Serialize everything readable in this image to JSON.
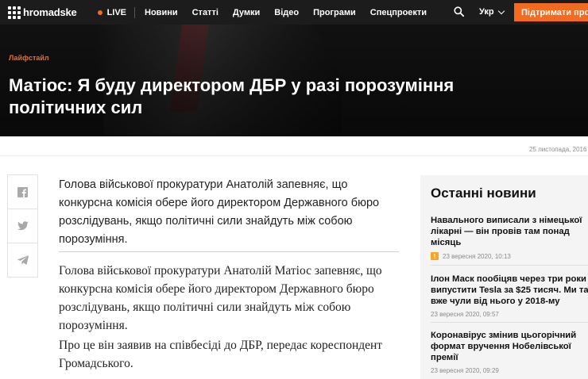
{
  "header": {
    "logo_text": "hromadske",
    "live_label": "LIVE",
    "nav": [
      "Новини",
      "Статті",
      "Думки",
      "Відео",
      "Програми",
      "Спецпроекти"
    ],
    "language": "Укр",
    "support_label": "Підтримати проект"
  },
  "hero": {
    "category": "Лайфстайл",
    "title": "Матіос: Я буду директором ДБР у разі порозуміння політичних сил"
  },
  "article": {
    "date": "25 листопада, 2016",
    "lead": "Голова військової прокуратури Анатолій запевняє, що конкурсна комісія обере його директором Державного бюро розслідувань, якщо політичні сили знайдуть між собою порозуміння.",
    "paragraphs": [
      "Голова військової прокуратури Анатолій Матіос запевняє, що конкурсна комісія обере його директором Державного бюро розслідувань, якщо політичні сили знайдуть між собою порозуміння.",
      "Про це він заявив на співбесіді до ДБР, передає кореспондент Громадського."
    ]
  },
  "sidebar": {
    "title": "Останні новини",
    "items": [
      {
        "title": "Навального виписали з німецької лікарні — він провів там понад місяць",
        "time": "23 вересня 2020, 10:13",
        "badge": "!"
      },
      {
        "title": "Ілон Маск пообіцяв через три роки випустити Tesla за $25 тисяч. Ми так вже чули від нього у 2018-му",
        "time": "23 вересня 2020, 09:57"
      },
      {
        "title": "Коронавірус змінив цьогорічний формат вручення Нобелівської премії",
        "time": "23 вересня 2020, 09:29"
      }
    ]
  },
  "colors": {
    "accent": "#f26b21",
    "nav_bg": "#1c1c1c",
    "badge": "#f5a623"
  },
  "icons": {
    "share": [
      "facebook-icon",
      "twitter-icon",
      "telegram-icon"
    ],
    "search": "search-icon"
  }
}
